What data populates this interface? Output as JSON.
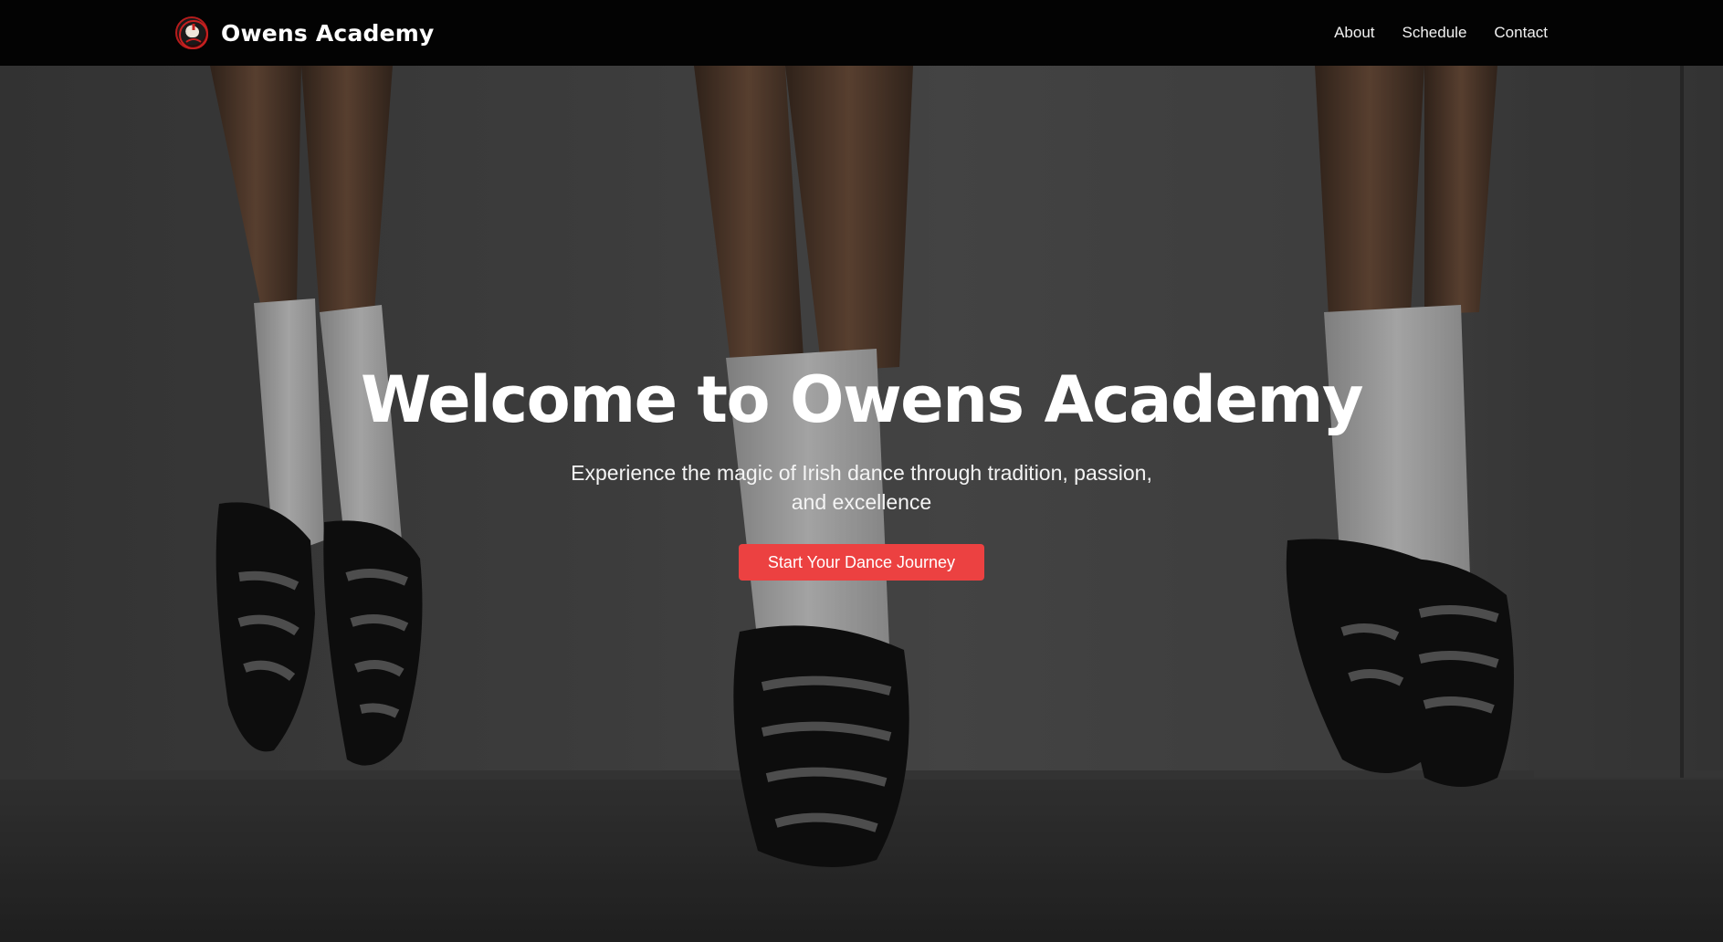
{
  "nav": {
    "brand_name": "Owens Academy",
    "logo_icon": "academy-logo-icon",
    "links": [
      {
        "label": "About"
      },
      {
        "label": "Schedule"
      },
      {
        "label": "Contact"
      }
    ]
  },
  "hero": {
    "background_image": "irish-dancers-feet-photo",
    "title": "Welcome to Owens Academy",
    "subtitle": "Experience the magic of Irish dance through tradition, passion, and excellence",
    "cta_label": "Start Your Dance Journey"
  },
  "colors": {
    "navbar_bg": "#030303",
    "accent": "#ec4141",
    "text": "#ffffff"
  }
}
